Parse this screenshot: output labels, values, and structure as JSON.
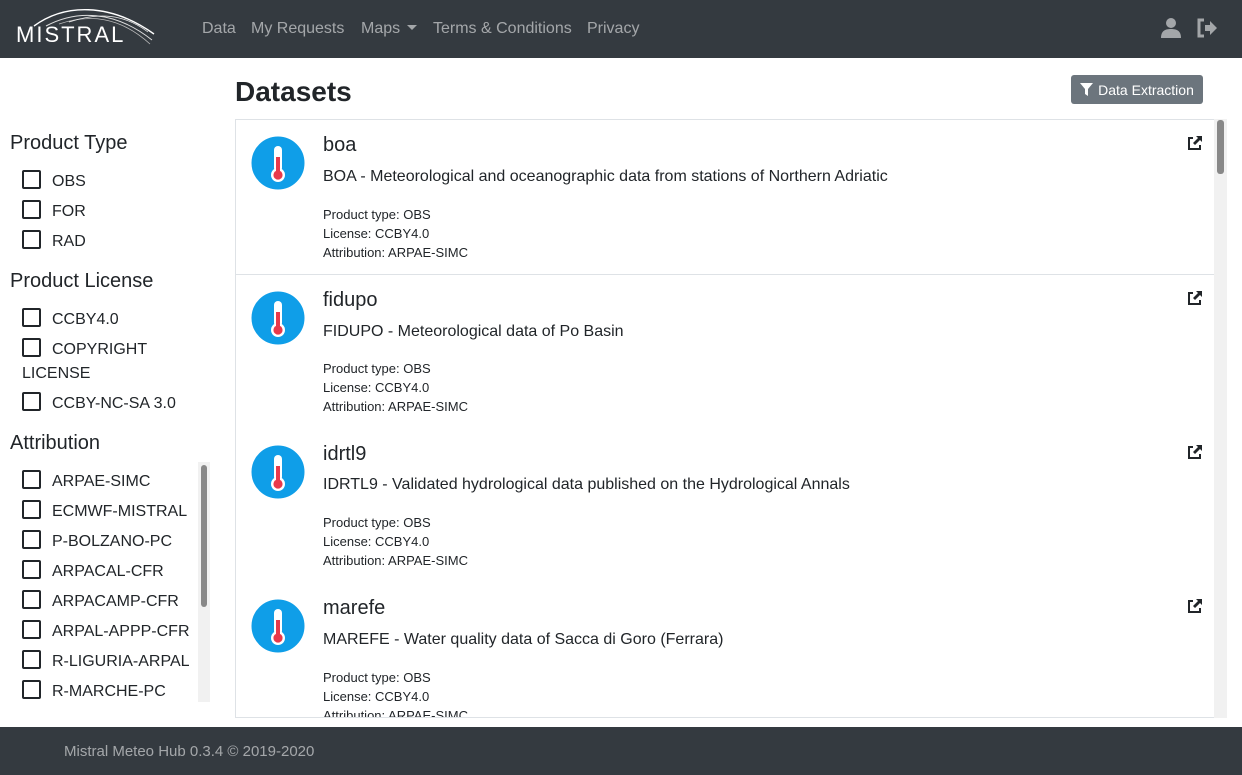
{
  "navbar": {
    "brand": "MISTRAL",
    "links": [
      "Data",
      "My Requests",
      "Maps",
      "Terms & Conditions",
      "Privacy"
    ],
    "icons": [
      "user-icon",
      "sign-out-icon"
    ]
  },
  "sidebar": {
    "product_type": {
      "title": "Product Type",
      "items": [
        "OBS",
        "FOR",
        "RAD"
      ]
    },
    "product_license": {
      "title": "Product License",
      "items": [
        "CCBY4.0",
        "COPYRIGHT LICENSE",
        "CCBY-NC-SA 3.0"
      ]
    },
    "attribution": {
      "title": "Attribution",
      "items": [
        "ARPAE-SIMC",
        "ECMWF-MISTRAL",
        "P-BOLZANO-PC",
        "ARPACAL-CFR",
        "ARPACAMP-CFR",
        "ARPAL-APPP-CFR",
        "R-LIGURIA-ARPAL",
        "R-MARCHE-PC"
      ]
    }
  },
  "main": {
    "title": "Datasets",
    "extract_button": "Data Extraction",
    "datasets": [
      {
        "name": "boa",
        "description": "BOA - Meteorological and oceanographic data from stations of Northern Adriatic",
        "product_type": "Product type: OBS",
        "license": "License: CCBY4.0",
        "attribution": "Attribution: ARPAE-SIMC"
      },
      {
        "name": "fidupo",
        "description": "FIDUPO - Meteorological data of Po Basin",
        "product_type": "Product type: OBS",
        "license": "License: CCBY4.0",
        "attribution": "Attribution: ARPAE-SIMC"
      },
      {
        "name": "idrtl9",
        "description": "IDRTL9 - Validated hydrological data published on the Hydrological Annals",
        "product_type": "Product type: OBS",
        "license": "License: CCBY4.0",
        "attribution": "Attribution: ARPAE-SIMC"
      },
      {
        "name": "marefe",
        "description": "MAREFE - Water quality data of Sacca di Goro (Ferrara)",
        "product_type": "Product type: OBS",
        "license": "License: CCBY4.0",
        "attribution": "Attribution: ARPAE-SIMC"
      }
    ]
  },
  "footer": {
    "text": "Mistral Meteo Hub 0.3.4 © 2019-2020"
  },
  "colors": {
    "navbar": "#343a40",
    "icon_blue": "#0f9ee8",
    "thermometer_red": "#e8394b",
    "button_gray": "#6c757d"
  }
}
